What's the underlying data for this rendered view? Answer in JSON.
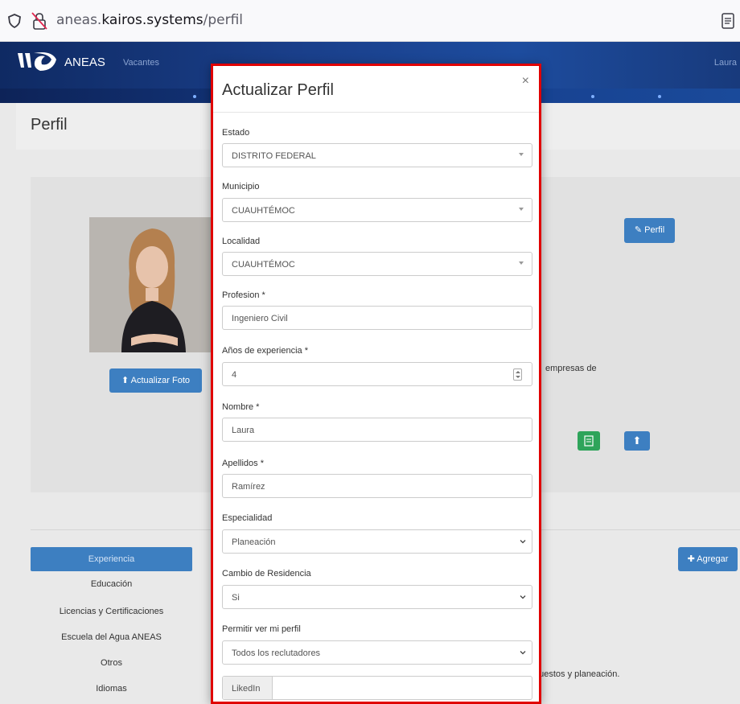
{
  "browser": {
    "url_prefix": "aneas.",
    "url_domain": "kairos.systems",
    "url_path": "/perfil"
  },
  "navbar": {
    "brand": "ANEAS",
    "link_vacantes": "Vacantes",
    "user": "Laura"
  },
  "page": {
    "title": "Perfil",
    "perfil_button": "Perfil",
    "update_photo_button": "Actualizar Foto",
    "text_empresas": "empresas de",
    "text_puestos": "puestos y planeación.",
    "agregar_button": "Agregar"
  },
  "sidebar": {
    "items": [
      {
        "label": "Experiencia"
      },
      {
        "label": "Educación"
      },
      {
        "label": "Licencias y Certificaciones"
      },
      {
        "label": "Escuela del Agua ANEAS"
      },
      {
        "label": "Otros"
      },
      {
        "label": "Idiomas"
      }
    ]
  },
  "modal": {
    "title": "Actualizar Perfil",
    "close": "×",
    "estado_label": "Estado",
    "estado_value": "DISTRITO FEDERAL",
    "municipio_label": "Municipio",
    "municipio_value": "CUAUHTÉMOC",
    "localidad_label": "Localidad",
    "localidad_value": "CUAUHTÉMOC",
    "profesion_label": "Profesion *",
    "profesion_value": "Ingeniero Civil",
    "experiencia_label": "Años de experiencia *",
    "experiencia_value": "4",
    "nombre_label": "Nombre *",
    "nombre_value": "Laura",
    "apellidos_label": "Apellidos *",
    "apellidos_value": "Ramírez",
    "especialidad_label": "Especialidad",
    "especialidad_value": "Planeación",
    "residencia_label": "Cambio de Residencia",
    "residencia_value": "Si",
    "permitir_label": "Permitir ver mi perfil",
    "permitir_value": "Todos los reclutadores",
    "linkedin_addon": "LikedIn",
    "linkedin_value": ""
  },
  "colors": {
    "accent": "#3d7fc1",
    "highlight_border": "#e00000",
    "success": "#2ea45a"
  }
}
